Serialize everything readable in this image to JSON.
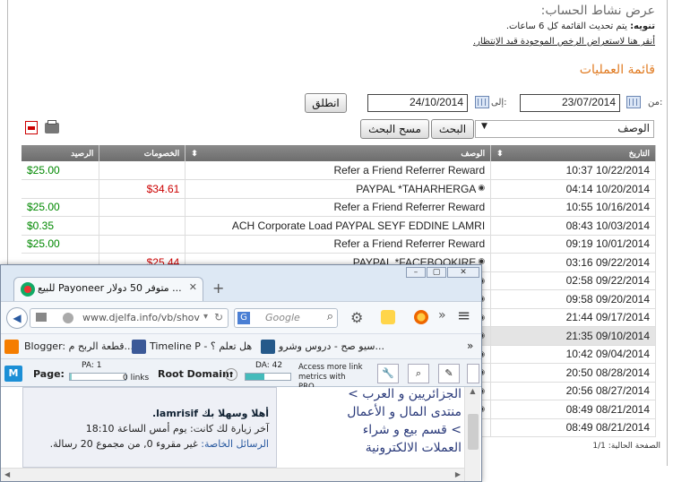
{
  "header": {
    "title": "عرض نشاط الحساب:",
    "note_bold": "تنويه:",
    "note": "يتم تحديث القائمة كل 6 ساعات.",
    "link": "أنقر هنا لاستعراض الرخص الموجودة قيد الإنتظار.",
    "subtitle": "قائمة العمليات"
  },
  "filters": {
    "from_label": "من:",
    "from_date": "23/07/2014",
    "to_label": "إلى:",
    "to_date": "24/10/2014",
    "go_button": "انطلق",
    "search_field_selected": "الوصف",
    "search_button": "البحث",
    "clear_button": "مسح البحث"
  },
  "table": {
    "headers": {
      "date": "التاريخ",
      "description": "الوصف",
      "debits": "الخصومات",
      "balance": "الرصيد"
    },
    "rows": [
      {
        "date": "10:37 10/22/2014",
        "description": "Refer a Friend Referrer Reward",
        "debit": "",
        "balance": "$25.00"
      },
      {
        "date": "04:14 10/20/2014",
        "description": "PAYPAL *TAHARHERGA",
        "debit": "$34.61",
        "balance": ""
      },
      {
        "date": "10:55 10/16/2014",
        "description": "Refer a Friend Referrer Reward",
        "debit": "",
        "balance": "$25.00"
      },
      {
        "date": "08:43 10/03/2014",
        "description": "ACH Corporate Load PAYPAL SEYF EDDINE LAMRI",
        "debit": "",
        "balance": "$0.35"
      },
      {
        "date": "09:19 10/01/2014",
        "description": "Refer a Friend Referrer Reward",
        "debit": "",
        "balance": "$25.00"
      },
      {
        "date": "03:16 09/22/2014",
        "description": "PAYPAL *FACEBOOKIRE",
        "debit": "$25.44",
        "balance": ""
      },
      {
        "date": "02:58 09/22/2014",
        "description": "",
        "debit": "",
        "balance": ""
      },
      {
        "date": "09:58 09/20/2014",
        "description": "",
        "debit": "",
        "balance": ""
      },
      {
        "date": "21:44 09/17/2014",
        "description": "",
        "debit": "",
        "balance": ""
      },
      {
        "date": "21:35 09/10/2014",
        "description": "",
        "debit": "",
        "balance": ""
      },
      {
        "date": "10:42 09/04/2014",
        "description": "",
        "debit": "",
        "balance": ""
      },
      {
        "date": "20:50 08/28/2014",
        "description": "",
        "debit": "",
        "balance": ""
      },
      {
        "date": "20:56 08/27/2014",
        "description": "",
        "debit": "",
        "balance": ""
      },
      {
        "date": "08:49 08/21/2014",
        "description": "",
        "debit": "",
        "balance": ""
      },
      {
        "date": "08:49 08/21/2014",
        "description": "",
        "debit": "",
        "balance": ""
      }
    ]
  },
  "footer": {
    "pages_label": "الصفحة الحالية:",
    "pages_value": "1/1"
  },
  "browser": {
    "tab_title": "للبيع Payoneer متوفر 50 دولار ...",
    "new_tab": "+",
    "url": "www.djelfa.info/vb/shov",
    "search_placeholder": "Google",
    "bookmarks": [
      "Blogger: قطعة الربح م...",
      "Timeline P - هل تعلم ؟",
      "سيو صح - دروس وشرو..."
    ],
    "seo": {
      "page_label": "Page:",
      "pa": "PA: 1",
      "links": "0 links",
      "root_label": "Root Domain:",
      "da": "DA: 42",
      "access": "Access more link metrics with PRO"
    },
    "page": {
      "welcome": "أهلا وسهلا بك lamrisif.",
      "last_visit_label": "آخر زيارة لك كانت: يوم أمس الساعة",
      "last_visit_time": "18:10",
      "pm_label": "الرسائل الخاصة:",
      "pm_text": "غير مقروء 0, من مجموع 20 رسالة.",
      "nav_1": "الجزائريين و العرب >",
      "nav_2": "منتدى المال و الأعمال",
      "nav_3": "> قسم بيع و شراء",
      "nav_4": "العملات الالكترونية"
    }
  }
}
